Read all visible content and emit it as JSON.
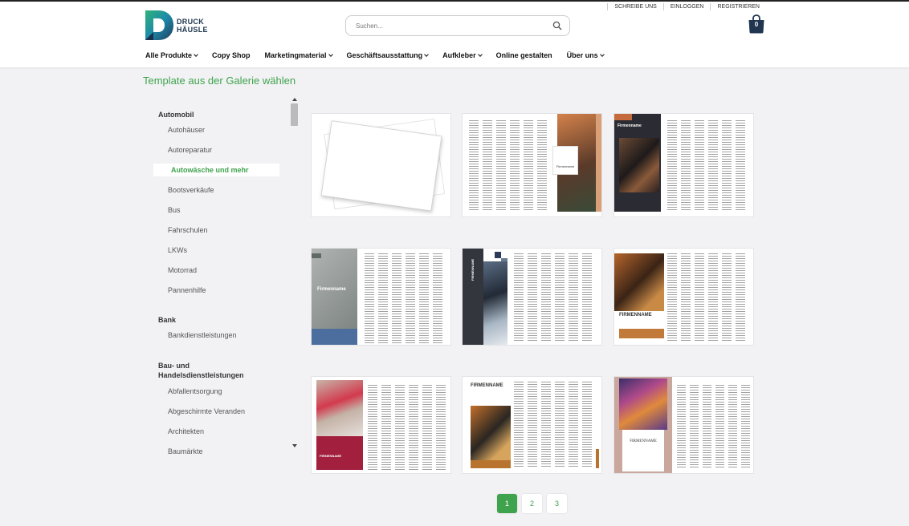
{
  "header": {
    "top_links": [
      "SCHREIBE UNS",
      "EINLOGGEN",
      "REGISTRIEREN"
    ],
    "logo": {
      "line1": "DRUCK",
      "line2": "HÄUSLE"
    },
    "search": {
      "placeholder": "Suchen..."
    },
    "cart_count": "0",
    "nav": [
      {
        "label": "Alle Produkte",
        "dropdown": true
      },
      {
        "label": "Copy Shop",
        "dropdown": false
      },
      {
        "label": "Marketingmaterial",
        "dropdown": true
      },
      {
        "label": "Geschäftsausstattung",
        "dropdown": true
      },
      {
        "label": "Aufkleber",
        "dropdown": true
      },
      {
        "label": "Online gestalten",
        "dropdown": false
      },
      {
        "label": "Über uns",
        "dropdown": true
      }
    ]
  },
  "page_title": "Template aus der Galerie wählen",
  "sidebar": {
    "categories": [
      {
        "label": "Automobil",
        "items": [
          "Autohäuser",
          "Autoreparatur",
          "Autowäsche und mehr",
          "Bootsverkäufe",
          "Bus",
          "Fahrschulen",
          "LKWs",
          "Motorrad",
          "Pannenhilfe"
        ]
      },
      {
        "label": "Bank",
        "items": [
          "Bankdienstleistungen"
        ]
      },
      {
        "label": "Bau- und Handelsdienstleistungen",
        "items": [
          "Abfallentsorgung",
          "Abgeschirmte Veranden",
          "Architekten",
          "Baumärkte"
        ]
      }
    ],
    "active_item": "Autowäsche und mehr"
  },
  "templates": [
    {
      "label": ""
    },
    {
      "label": "Firmenname"
    },
    {
      "label": "Firmenname"
    },
    {
      "label": "Firmenname"
    },
    {
      "label": "FIRMENNAME"
    },
    {
      "label": "FIRMENNAME"
    },
    {
      "label": "FIRMENNAME"
    },
    {
      "label": "FIRMENNAME"
    },
    {
      "label": "FIRMENNAME"
    }
  ],
  "pagination": {
    "pages": [
      "1",
      "2",
      "3"
    ],
    "current": "1"
  },
  "colors": {
    "accent": "#3fa34d",
    "logo_dark": "#1f3550",
    "cart": "#1f3550"
  }
}
